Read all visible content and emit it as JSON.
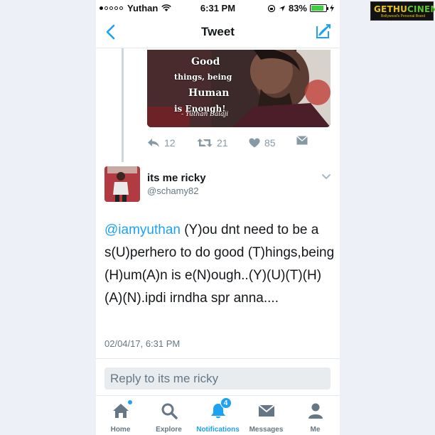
{
  "status_bar": {
    "carrier": "Yuthan",
    "time": "6:31 PM",
    "battery": "83%",
    "battery_level": 0.83
  },
  "nav": {
    "title": "Tweet",
    "back_icon": "chevron-left-icon",
    "compose_icon": "compose-icon"
  },
  "image_tweet": {
    "image_text": [
      "Good",
      "things, being",
      "Human",
      "is Enough!"
    ],
    "image_signature": "- Yuthan Balaji",
    "replies": "12",
    "retweets": "21",
    "likes": "85"
  },
  "reply_tweet": {
    "name": "its me ricky",
    "handle": "@schamy82",
    "mention": "@iamyuthan",
    "text": " (Y)ou dnt need to be a s(U)perhero to do good (T)hings,being (H)um(A)n is e(N)ough..(Y)(U)(T)(H)(A)(N).ipdi irndha spr anna....",
    "timestamp": "02/04/17, 6:31 PM"
  },
  "reply_box": {
    "placeholder": "Reply to its me ricky"
  },
  "tabs": [
    {
      "label": "Home",
      "icon": "home-icon",
      "indicator": "dot"
    },
    {
      "label": "Explore",
      "icon": "search-icon"
    },
    {
      "label": "Notifications",
      "icon": "bell-icon",
      "badge": "4",
      "active": true
    },
    {
      "label": "Messages",
      "icon": "envelope-icon"
    },
    {
      "label": "Me",
      "icon": "person-icon"
    }
  ],
  "watermark": {
    "title_part1": "GETHU",
    "title_part2": "CINEMA",
    "subtitle": "Bollywood's Personal Brand"
  },
  "colors": {
    "accent": "#1da1f2",
    "text": "#14171a",
    "muted": "#657786"
  }
}
